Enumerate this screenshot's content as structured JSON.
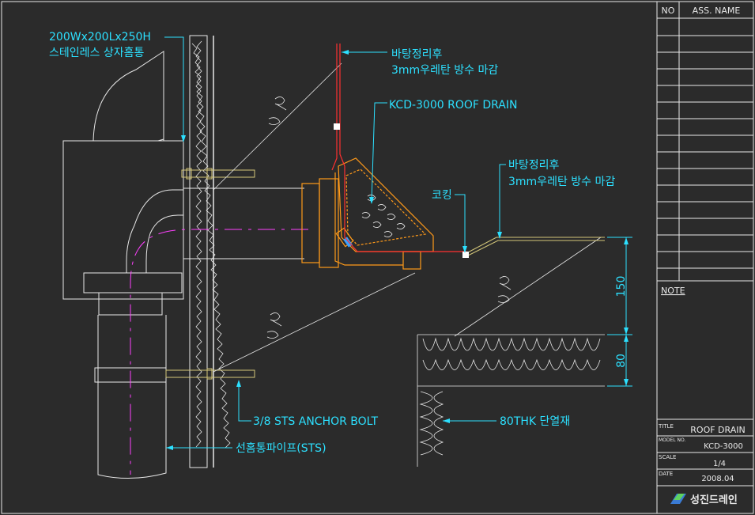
{
  "labels": {
    "box_size": "200Wx200Lx250H",
    "box_name": "스테인레스 상자홈통",
    "waterproof_top_1": "바탕정리후",
    "waterproof_top_2": "3mm우레탄 방수 마감",
    "drain_name": "KCD-3000 ROOF DRAIN",
    "caulking": "코킹",
    "waterproof_right_1": "바탕정리후",
    "waterproof_right_2": "3mm우레탄 방수 마감",
    "anchor_bolt": "3/8 STS ANCHOR BOLT",
    "insulation": "80THK 단열재",
    "pipe": "선홈통파이프(STS)"
  },
  "dimensions": {
    "upper": "150",
    "lower": "80"
  },
  "title_block": {
    "col_no": "NO",
    "col_name": "ASS. NAME",
    "note": "NOTE",
    "title_key": "TITLE",
    "title_val": "ROOF DRAIN",
    "model_key": "MODEL NO.",
    "model_val": "KCD-3000",
    "scale_key": "SCALE",
    "scale_val": "1/4",
    "date_key": "DATE",
    "date_val": "2008.04",
    "company": "성진드레인"
  },
  "colors": {
    "background": "#2b2b2b",
    "leader": "#2ce0ff",
    "drain_body": "#ff9a1a",
    "waterproof": "#ff3030",
    "centerline": "#ff40ff",
    "frame": "#e8e8e8"
  }
}
